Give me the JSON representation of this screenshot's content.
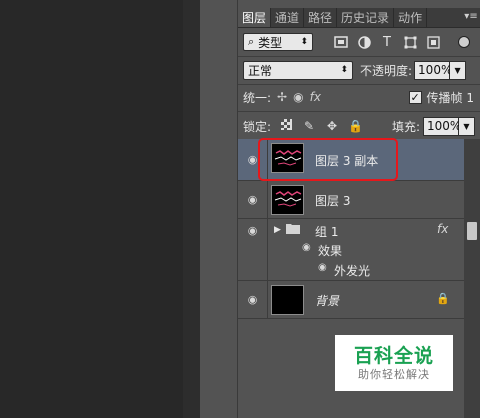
{
  "tabs": [
    {
      "label": "图层",
      "active": true
    },
    {
      "label": "通道",
      "active": false
    },
    {
      "label": "路径",
      "active": false
    },
    {
      "label": "历史记录",
      "active": false
    },
    {
      "label": "动作",
      "active": false
    }
  ],
  "panel_menu_icon": "panel-menu-icon",
  "filter": {
    "prefix_icon": "search-icon",
    "type_value": "类型",
    "icons": [
      "image-filter-icon",
      "adjustment-filter-icon",
      "type-filter-icon",
      "shape-filter-icon",
      "smart-object-filter-icon"
    ]
  },
  "blend": {
    "mode": "正常",
    "opacity_label": "不透明度:",
    "opacity_value": "100%"
  },
  "unify": {
    "label": "统一:",
    "propagate_label": "传播帧 1",
    "propagate_checked": true
  },
  "lock": {
    "label": "锁定:",
    "fill_label": "填充:",
    "fill_value": "100%"
  },
  "layers": [
    {
      "name": "图层 3 副本",
      "selected": true,
      "visible": true
    },
    {
      "name": "图层 3",
      "selected": false,
      "visible": true
    },
    {
      "name": "组 1",
      "selected": false,
      "visible": true,
      "is_group": true,
      "fx": "fx",
      "effects_label": "效果",
      "effect_items": [
        "外发光"
      ]
    },
    {
      "name": "背景",
      "selected": false,
      "visible": true,
      "locked": true
    }
  ],
  "watermark": {
    "logo": "百科全说",
    "tagline": "助你轻松解决"
  },
  "colors": {
    "panel_bg": "#535353",
    "selected_layer": "#5b677a",
    "highlight_box": "#e6171b",
    "watermark_green": "#1aa152"
  }
}
